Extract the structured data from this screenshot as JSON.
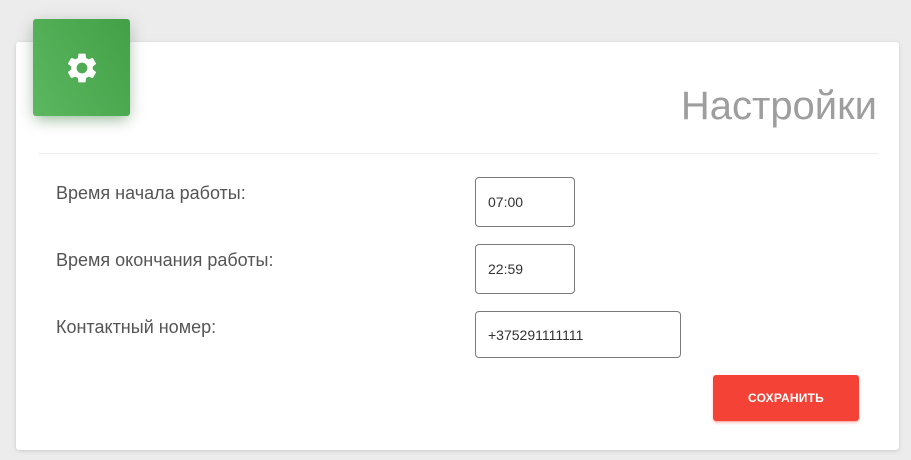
{
  "header": {
    "icon": "gear-icon",
    "title": "Настройки"
  },
  "fields": [
    {
      "label": "Время начала работы:",
      "value": "07:00"
    },
    {
      "label": "Время окончания работы:",
      "value": "22:59"
    },
    {
      "label": "Контактный номер:",
      "value": "+375291111111"
    }
  ],
  "actions": {
    "save_label": "СОХРАНИТЬ"
  },
  "colors": {
    "header_icon_bg": "#4caf50",
    "save_button_bg": "#f44336",
    "title_text": "#9e9e9e"
  }
}
